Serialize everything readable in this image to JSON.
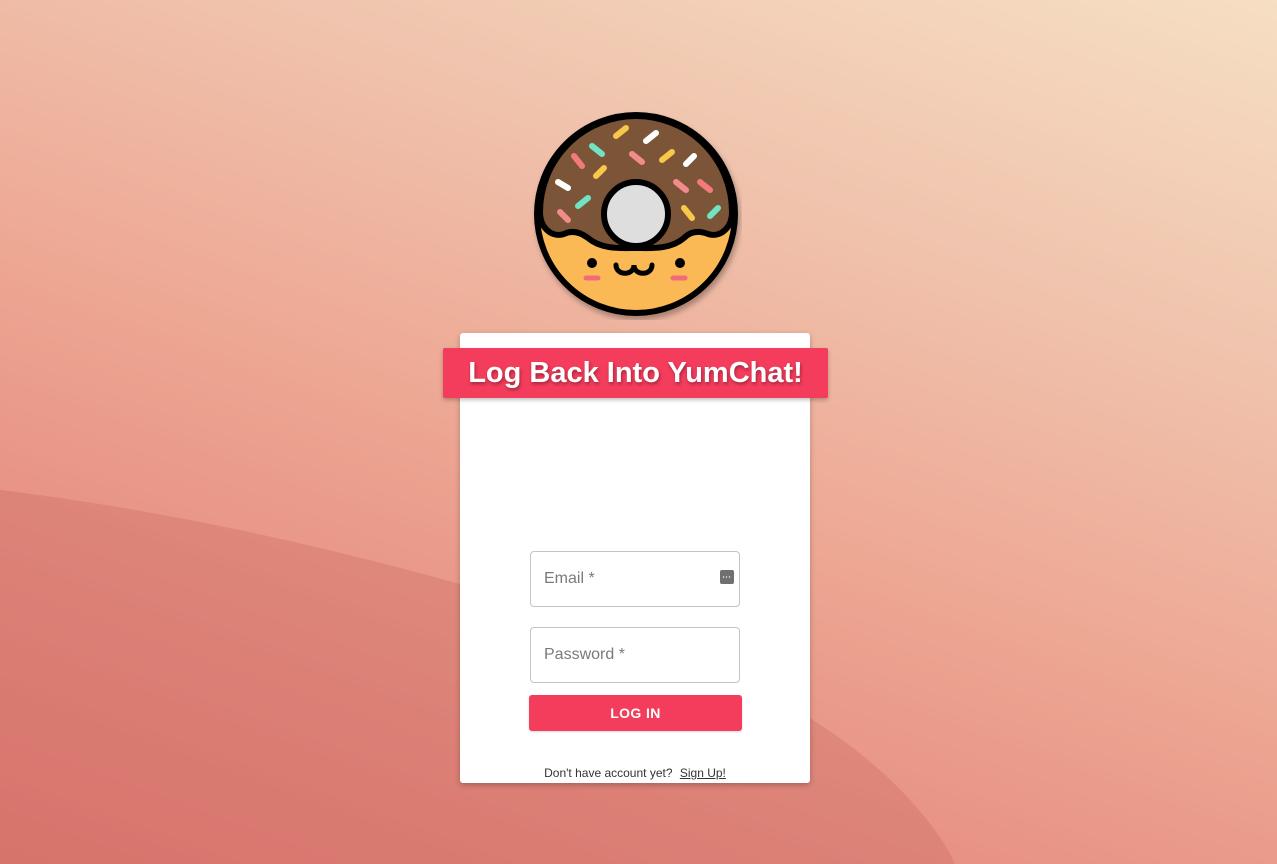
{
  "app": {
    "title": "Log Back Into YumChat!"
  },
  "login_form": {
    "email_placeholder": "Email *",
    "password_placeholder": "Password *",
    "login_button_label": "LOG IN",
    "signup_prompt": "Don't have account yet?",
    "signup_link_label": "Sign Up!"
  },
  "icons": {
    "logo": "donut-mascot-icon",
    "email_field_icon": "password-manager-key-icon"
  },
  "colors": {
    "accent": "#f43c5c",
    "card_background": "#ffffff",
    "donut_frosting": "#7b5537",
    "donut_dough": "#fbb954"
  }
}
